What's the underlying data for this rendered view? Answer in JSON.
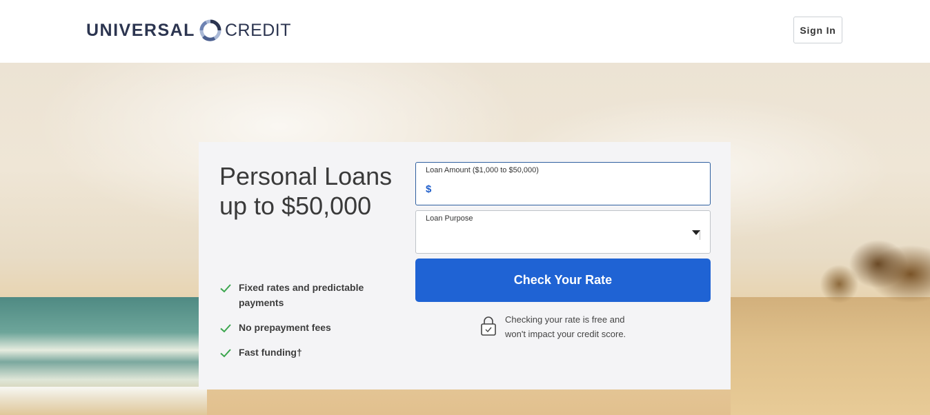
{
  "header": {
    "logo_left": "UNIVERSAL",
    "logo_right": "CREDIT",
    "signin_label": "Sign In"
  },
  "hero": {
    "headline": "Personal Loans up to $50,000",
    "features": [
      "Fixed rates and predictable payments",
      "No prepayment fees",
      "Fast funding†"
    ]
  },
  "form": {
    "amount": {
      "label": "Loan Amount ($1,000 to $50,000)",
      "currency": "$",
      "value": ""
    },
    "purpose": {
      "label": "Loan Purpose",
      "selected": ""
    },
    "cta_label": "Check Your Rate",
    "note": "Checking your rate is free and won't impact your credit score."
  },
  "colors": {
    "brand_navy": "#2c3550",
    "cta_blue": "#1f63d4",
    "check_green": "#3aa54c"
  },
  "icons": {
    "feature": "checkmark-icon",
    "note": "lock-icon",
    "select": "caret-down-icon"
  }
}
